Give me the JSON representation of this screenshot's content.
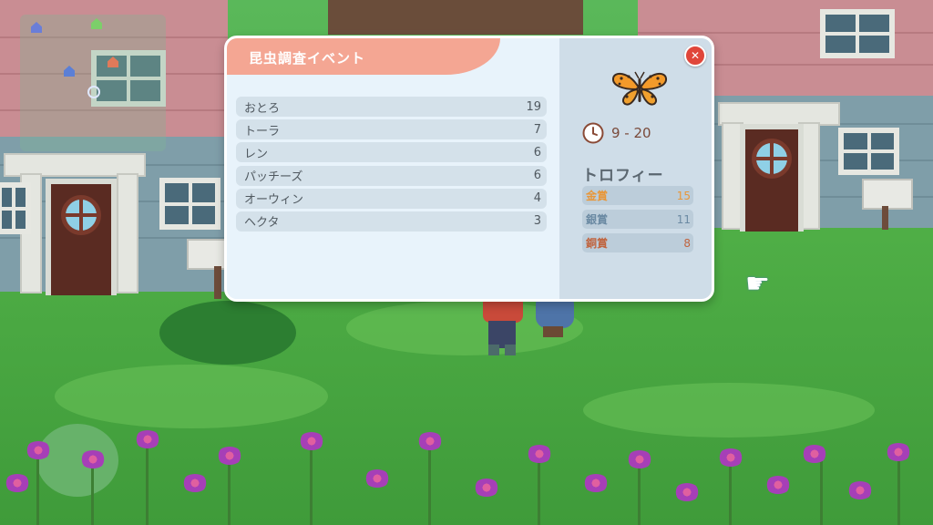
{
  "event_panel": {
    "title": "昆虫調査イベント",
    "ranking": [
      {
        "name": "おとろ",
        "score": "19"
      },
      {
        "name": "トーラ",
        "score": "7"
      },
      {
        "name": "レン",
        "score": "6"
      },
      {
        "name": "パッチーズ",
        "score": "6"
      },
      {
        "name": "オーウィン",
        "score": "4"
      },
      {
        "name": "ヘクタ",
        "score": "3"
      }
    ],
    "insect_icon": "butterfly-icon",
    "time_icon": "clock-icon",
    "time_range": "9 - 20",
    "trophy_title": "トロフィー",
    "trophies": [
      {
        "name": "金賞",
        "value": "15",
        "color": "#e8973a"
      },
      {
        "name": "銀賞",
        "value": "11",
        "color": "#6b8aa3"
      },
      {
        "name": "銅賞",
        "value": "8",
        "color": "#c0643f"
      }
    ],
    "close_icon": "close-icon"
  },
  "colors": {
    "accent": "#f4a693",
    "panel_bg": "#e8f3fb",
    "side_bg": "#cfdde8",
    "close_red": "#e0463a"
  }
}
